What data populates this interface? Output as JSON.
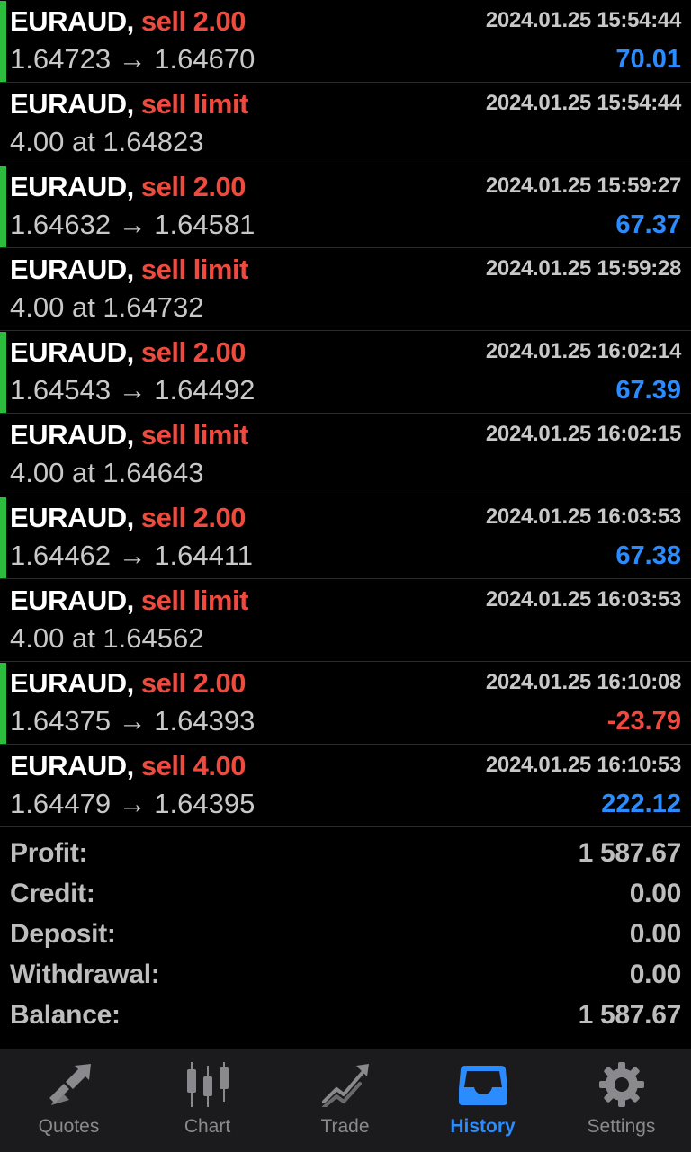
{
  "deals": [
    {
      "symbol": "EURAUD,",
      "action": "sell 2.00",
      "time": "2024.01.25 15:54:44",
      "prices": "1.64723 → 1.64670",
      "profit": "70.01",
      "profit_color": "#2a8cff",
      "closed": true
    },
    {
      "symbol": "EURAUD,",
      "action": "sell limit",
      "time": "2024.01.25 15:54:44",
      "prices": "4.00 at 1.64823",
      "profit": "",
      "closed": false
    },
    {
      "symbol": "EURAUD,",
      "action": "sell 2.00",
      "time": "2024.01.25 15:59:27",
      "prices": "1.64632 → 1.64581",
      "profit": "67.37",
      "profit_color": "#2a8cff",
      "closed": true
    },
    {
      "symbol": "EURAUD,",
      "action": "sell limit",
      "time": "2024.01.25 15:59:28",
      "prices": "4.00 at 1.64732",
      "profit": "",
      "closed": false
    },
    {
      "symbol": "EURAUD,",
      "action": "sell 2.00",
      "time": "2024.01.25 16:02:14",
      "prices": "1.64543 → 1.64492",
      "profit": "67.39",
      "profit_color": "#2a8cff",
      "closed": true
    },
    {
      "symbol": "EURAUD,",
      "action": "sell limit",
      "time": "2024.01.25 16:02:15",
      "prices": "4.00 at 1.64643",
      "profit": "",
      "closed": false
    },
    {
      "symbol": "EURAUD,",
      "action": "sell 2.00",
      "time": "2024.01.25 16:03:53",
      "prices": "1.64462 → 1.64411",
      "profit": "67.38",
      "profit_color": "#2a8cff",
      "closed": true
    },
    {
      "symbol": "EURAUD,",
      "action": "sell limit",
      "time": "2024.01.25 16:03:53",
      "prices": "4.00 at 1.64562",
      "profit": "",
      "closed": false
    },
    {
      "symbol": "EURAUD,",
      "action": "sell 2.00",
      "time": "2024.01.25 16:10:08",
      "prices": "1.64375 → 1.64393",
      "profit": "-23.79",
      "profit_color": "#f0493e",
      "closed": true
    },
    {
      "symbol": "EURAUD,",
      "action": "sell 4.00",
      "time": "2024.01.25 16:10:53",
      "prices": "1.64479 → 1.64395",
      "profit": "222.12",
      "profit_color": "#2a8cff",
      "closed": false
    }
  ],
  "summary": {
    "profit_label": "Profit:",
    "profit_value": "1 587.67",
    "credit_label": "Credit:",
    "credit_value": "0.00",
    "deposit_label": "Deposit:",
    "deposit_value": "0.00",
    "withdrawal_label": "Withdrawal:",
    "withdrawal_value": "0.00",
    "balance_label": "Balance:",
    "balance_value": "1 587.67"
  },
  "tabs": [
    {
      "label": "Quotes",
      "icon": "quotes-icon",
      "active": false
    },
    {
      "label": "Chart",
      "icon": "chart-icon",
      "active": false
    },
    {
      "label": "Trade",
      "icon": "trade-icon",
      "active": false
    },
    {
      "label": "History",
      "icon": "history-icon",
      "active": true
    },
    {
      "label": "Settings",
      "icon": "gear-icon",
      "active": false
    }
  ],
  "colors": {
    "accent": "#2a8cff",
    "loss": "#f0493e",
    "sell": "#f0493e",
    "closed_marker": "#2dbd3e"
  }
}
